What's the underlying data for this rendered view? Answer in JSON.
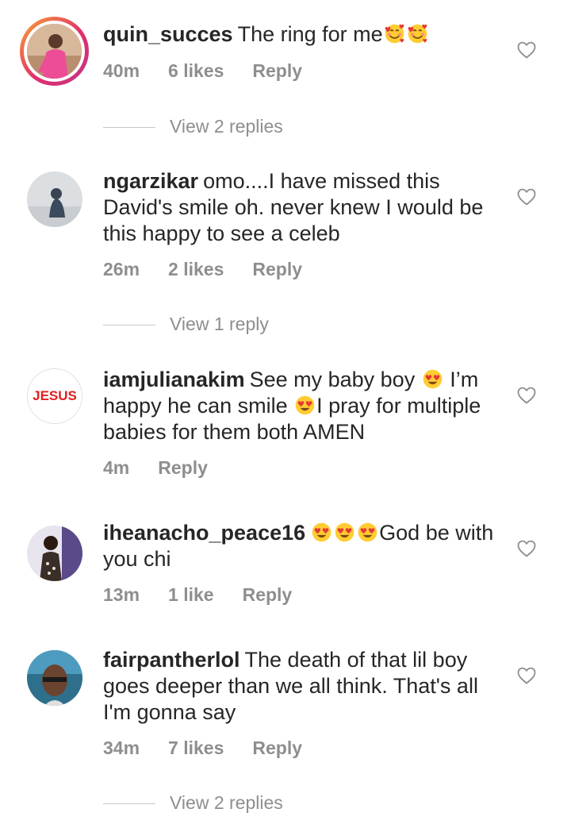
{
  "comments": [
    {
      "username": "quin_succes",
      "text": "The ring for me",
      "emoji_after": [
        "smiling-face-with-hearts",
        "smiling-face-with-hearts"
      ],
      "time": "40m",
      "likes": "6 likes",
      "reply": "Reply",
      "view_replies": "View 2 replies"
    },
    {
      "username": "ngarzikar",
      "text": "omo....I have missed this David's smile oh. never knew I would be this happy to see a celeb",
      "time": "26m",
      "likes": "2 likes",
      "reply": "Reply",
      "view_replies": "View 1 reply"
    },
    {
      "username": "iamjulianakim",
      "text_1": "See my baby boy",
      "text_2": "I’m happy he can smile",
      "text_3": "I pray for multiple babies for them both AMEN",
      "avatar_text": "JESUS",
      "time": "4m",
      "reply": "Reply"
    },
    {
      "username": "iheanacho_peace16",
      "text": "God be with you chi",
      "time": "13m",
      "likes": "1 like",
      "reply": "Reply"
    },
    {
      "username": "fairpantherlol",
      "text": "The death of that lil boy goes deeper than we all think. That's all I'm gonna say",
      "time": "34m",
      "likes": "7 likes",
      "reply": "Reply",
      "view_replies": "View 2 replies"
    }
  ],
  "colors": {
    "text": "#262626",
    "muted": "#8e8e8e",
    "story_ring_start": "#f9a530",
    "story_ring_end": "#c13584",
    "jesus_red": "#e02020"
  },
  "icons": {
    "like": "heart-outline-icon",
    "emoji_hearts": "smiling-face-with-hearts",
    "emoji_heart_eyes": "smiling-face-with-heart-eyes"
  }
}
